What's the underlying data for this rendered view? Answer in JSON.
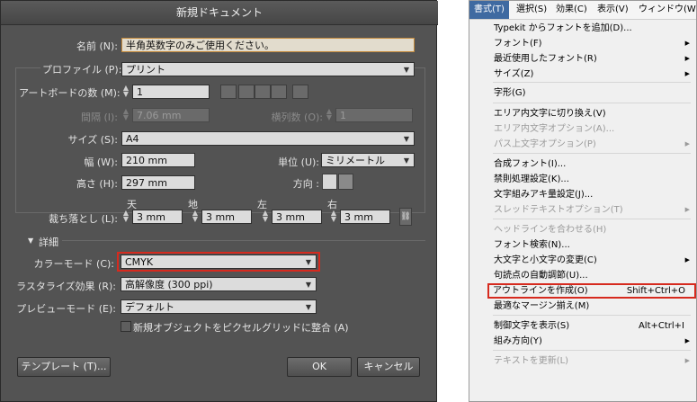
{
  "dialog": {
    "title": "新規ドキュメント",
    "name_label": "名前 (N):",
    "name_value": "半角英数字のみご使用ください。",
    "profile_label": "プロファイル (P):",
    "profile_value": "プリント",
    "artboards_label": "アートボードの数 (M):",
    "artboards_value": "1",
    "spacing_label": "間隔 (I):",
    "spacing_value": "7.06 mm",
    "columns_label": "横列数 (O):",
    "columns_value": "1",
    "size_label": "サイズ (S):",
    "size_value": "A4",
    "width_label": "幅 (W):",
    "width_value": "210 mm",
    "units_label": "単位 (U):",
    "units_value": "ミリメートル",
    "height_label": "高さ (H):",
    "height_value": "297 mm",
    "orientation_label": "方向 :",
    "bleed_label": "裁ち落とし (L):",
    "bleed_top_label": "天",
    "bleed_top_value": "3 mm",
    "bleed_bottom_label": "地",
    "bleed_bottom_value": "3 mm",
    "bleed_left_label": "左",
    "bleed_left_value": "3 mm",
    "bleed_right_label": "右",
    "bleed_right_value": "3 mm",
    "advanced_label": "詳細",
    "color_mode_label": "カラーモード (C):",
    "color_mode_value": "CMYK",
    "raster_label": "ラスタライズ効果 (R):",
    "raster_value": "高解像度 (300 ppi)",
    "preview_label": "プレビューモード (E):",
    "preview_value": "デフォルト",
    "pixel_grid_label": "新規オブジェクトをピクセルグリッドに整合 (A)",
    "template_button": "テンプレート (T)...",
    "ok_button": "OK",
    "cancel_button": "キャンセル"
  },
  "menu": {
    "bar": [
      "書式(T)",
      "選択(S)",
      "効果(C)",
      "表示(V)",
      "ウィンドウ(W"
    ],
    "items": [
      {
        "label": "Typekit からフォントを追加(D)...",
        "shortcut": "",
        "sub": false,
        "disabled": false
      },
      {
        "label": "フォント(F)",
        "shortcut": "",
        "sub": true,
        "disabled": false
      },
      {
        "label": "最近使用したフォント(R)",
        "shortcut": "",
        "sub": true,
        "disabled": false
      },
      {
        "label": "サイズ(Z)",
        "shortcut": "",
        "sub": true,
        "disabled": false
      },
      {
        "label": "字形(G)",
        "shortcut": "",
        "sub": false,
        "disabled": false
      },
      {
        "label": "エリア内文字に切り換え(V)",
        "shortcut": "",
        "sub": false,
        "disabled": false
      },
      {
        "label": "エリア内文字オプション(A)...",
        "shortcut": "",
        "sub": false,
        "disabled": true
      },
      {
        "label": "パス上文字オプション(P)",
        "shortcut": "",
        "sub": true,
        "disabled": true
      },
      {
        "label": "合成フォント(I)...",
        "shortcut": "",
        "sub": false,
        "disabled": false
      },
      {
        "label": "禁則処理設定(K)...",
        "shortcut": "",
        "sub": false,
        "disabled": false
      },
      {
        "label": "文字組みアキ量設定(J)...",
        "shortcut": "",
        "sub": false,
        "disabled": false
      },
      {
        "label": "スレッドテキストオプション(T)",
        "shortcut": "",
        "sub": true,
        "disabled": true
      },
      {
        "label": "ヘッドラインを合わせる(H)",
        "shortcut": "",
        "sub": false,
        "disabled": true
      },
      {
        "label": "フォント検索(N)...",
        "shortcut": "",
        "sub": false,
        "disabled": false
      },
      {
        "label": "大文字と小文字の変更(C)",
        "shortcut": "",
        "sub": true,
        "disabled": false
      },
      {
        "label": "句読点の自動調節(U)...",
        "shortcut": "",
        "sub": false,
        "disabled": false
      },
      {
        "label": "アウトラインを作成(O)",
        "shortcut": "Shift+Ctrl+O",
        "sub": false,
        "disabled": false
      },
      {
        "label": "最適なマージン揃え(M)",
        "shortcut": "",
        "sub": false,
        "disabled": false
      },
      {
        "label": "制御文字を表示(S)",
        "shortcut": "Alt+Ctrl+I",
        "sub": false,
        "disabled": false
      },
      {
        "label": "組み方向(Y)",
        "shortcut": "",
        "sub": true,
        "disabled": false
      },
      {
        "label": "テキストを更新(L)",
        "shortcut": "",
        "sub": true,
        "disabled": true
      }
    ]
  },
  "colors": {
    "highlight": "#d62a1e",
    "dialog_bg": "#535353",
    "menu_active": "#3f6aa1"
  }
}
